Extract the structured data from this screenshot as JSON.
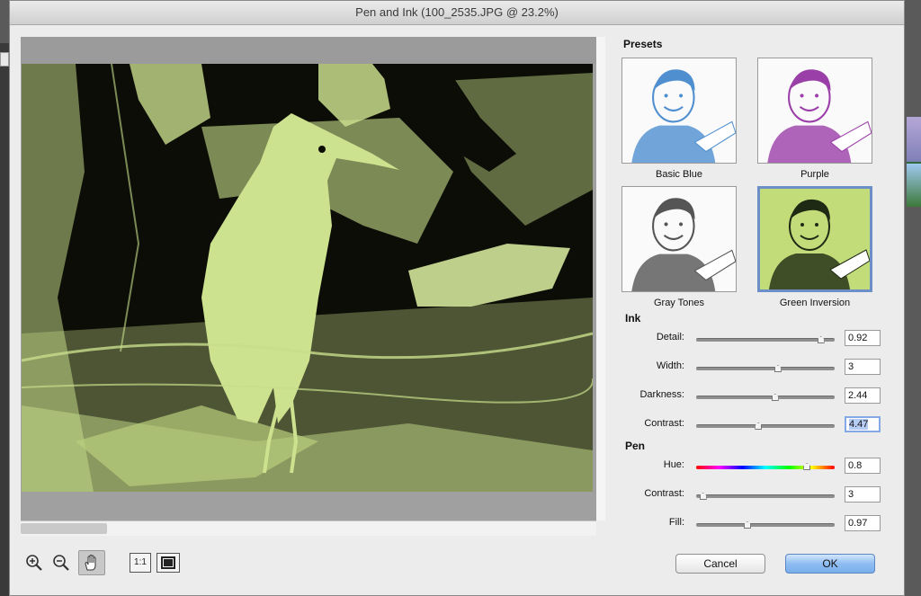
{
  "dialog": {
    "title": "Pen and Ink (100_2535.JPG @ 23.2%)"
  },
  "presets": {
    "heading": "Presets",
    "items": [
      {
        "label": "Basic Blue",
        "tint": "#4f8fcf",
        "selected": false
      },
      {
        "label": "Purple",
        "tint": "#9b3fa8",
        "selected": false
      },
      {
        "label": "Gray Tones",
        "tint": "#555555",
        "selected": false
      },
      {
        "label": "Green Inversion",
        "tint": "#c2dc7a",
        "selected": true
      }
    ]
  },
  "ink": {
    "heading": "Ink",
    "sliders": [
      {
        "label": "Detail:",
        "value": "0.92",
        "position": 0.9
      },
      {
        "label": "Width:",
        "value": "3",
        "position": 0.59
      },
      {
        "label": "Darkness:",
        "value": "2.44",
        "position": 0.57
      },
      {
        "label": "Contrast:",
        "value": "4.47",
        "position": 0.45,
        "focused": true
      }
    ]
  },
  "pen": {
    "heading": "Pen",
    "sliders": [
      {
        "label": "Hue:",
        "value": "0.8",
        "position": 0.8,
        "hue": true
      },
      {
        "label": "Contrast:",
        "value": "3",
        "position": 0.05
      },
      {
        "label": "Fill:",
        "value": "0.97",
        "position": 0.37
      }
    ]
  },
  "toolbar": {
    "zoom_in": "zoom-in-icon",
    "zoom_out": "zoom-out-icon",
    "hand": "hand-icon",
    "actual_size_label": "1:1",
    "fit": "fit-screen-icon"
  },
  "buttons": {
    "cancel": "Cancel",
    "ok": "OK"
  },
  "colors": {
    "accent": "#6d8fc7",
    "image_light": "#c8dd8c",
    "image_dark": "#0c0d06"
  }
}
